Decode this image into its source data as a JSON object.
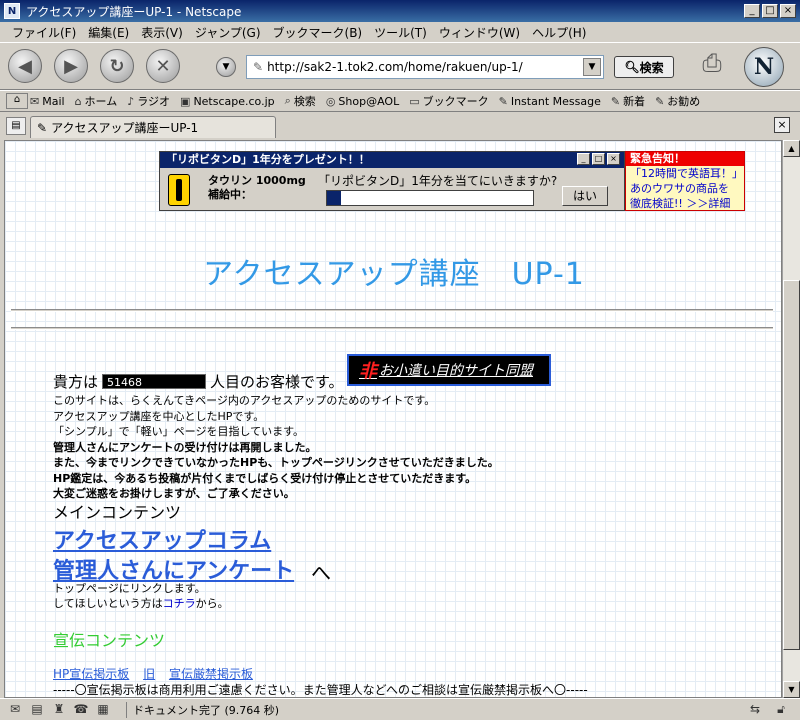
{
  "window": {
    "title": "アクセスアップ講座ーUP-1 - Netscape",
    "app_icon": "N"
  },
  "menu": [
    "ファイル(F)",
    "編集(E)",
    "表示(V)",
    "ジャンプ(G)",
    "ブックマーク(B)",
    "ツール(T)",
    "ウィンドウ(W)",
    "ヘルプ(H)"
  ],
  "nav": {
    "url": "http://sak2-1.tok2.com/home/rakuen/up-1/",
    "search_label": "検索",
    "logo": "N"
  },
  "bookmarks": [
    "Mail",
    "ホーム",
    "ラジオ",
    "Netscape.co.jp",
    "検索",
    "Shop@AOL",
    "ブックマーク",
    "Instant Message",
    "新着",
    "お勧め"
  ],
  "tab": {
    "label": "アクセスアップ講座ーUP-1"
  },
  "ad": {
    "title": "「リポビタンD」1年分をプレゼント！！",
    "product_line1": "タウリン 1000mg",
    "product_line2": "補給中：",
    "question": "「リポビタンD」1年分を当てにいきますか?",
    "progress": 0.07,
    "yes": "はい"
  },
  "alert": {
    "head": "緊急告知！",
    "line1": "「12時間で英語耳！」",
    "line2": "あのウワサの商品を",
    "line3": "徹底検証!! ＞＞詳細"
  },
  "page": {
    "title": "アクセスアップ講座　UP-1",
    "visitor_prefix": "貴方は",
    "counter": "51468",
    "visitor_suffix": "人目のお客様です。",
    "promo_mark": "非",
    "promo_text": "お小遣い目的サイト同盟",
    "desc": [
      "このサイトは、らくえんてきページ内のアクセスアップのためのサイトです。",
      "アクセスアップ講座を中心としたHPです。",
      "「シンプル」で「軽い」ページを目指しています。",
      "管理人さんにアンケートの受け付けは再開しました。",
      "また、今までリンクできていなかったHPも、トップページリンクさせていただきました。",
      "HP鑑定は、今あるち投稿が片付くまでしばらく受け付け停止とさせていただきます。",
      "大変ご迷惑をお掛けしますが、ご了承ください。"
    ],
    "main_heading": "メインコンテンツ",
    "link_column": "アクセスアップコラム",
    "link_survey": "管理人さんにアンケート",
    "link_survey_suffix": "へ",
    "note_line1": "トップページにリンクします。",
    "note_line2_prefix": "してほしいという方は",
    "note_line2_link": "コチラ",
    "note_line2_suffix": "から。",
    "ad_heading": "宣伝コンテンツ",
    "bbs_links": [
      "HP宣伝掲示板",
      "旧",
      "宣伝厳禁掲示板"
    ],
    "bbs_note": "-----〇宣伝掲示板は商用利用ご遠慮ください。また管理人などへのご相談は宣伝厳禁掲示板へ〇-----"
  },
  "status": {
    "text": "ドキュメント完了 (9.764 秒)"
  }
}
